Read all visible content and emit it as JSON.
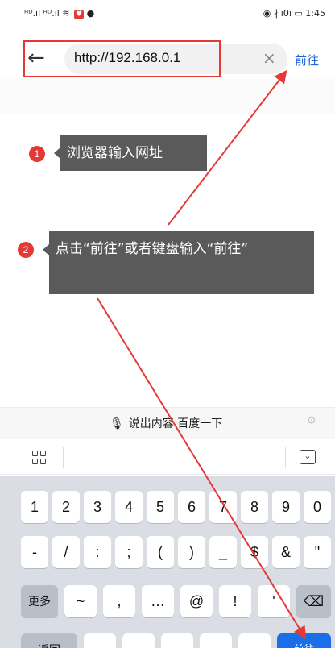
{
  "status_bar": {
    "signal_left": "ᴴᴰ.ıl ᴴᴰ.ıl ≋",
    "badge": "♥",
    "chat": "●",
    "right_icons": "◉ ∦ ı0ı ▭",
    "battery": "",
    "time": "1:45"
  },
  "address_bar": {
    "back_icon": "←",
    "url": "http://192.168.0.1",
    "clear_icon": "×",
    "go_label": "前往"
  },
  "callouts": [
    {
      "number": "1",
      "text": "浏览器输入网址"
    },
    {
      "number": "2",
      "text": "点击“前往”或者键盘输入“前往”"
    }
  ],
  "voice_bar": {
    "mic_icon": "🎙",
    "label": "说出内容 百度一下",
    "gear_icon": "⚙"
  },
  "keyboard": {
    "collapse_icon": "⌄",
    "row1": [
      "1",
      "2",
      "3",
      "4",
      "5",
      "6",
      "7",
      "8",
      "9",
      "0"
    ],
    "row2": [
      "-",
      "/",
      ":",
      ";",
      "(",
      ")",
      "_",
      "$",
      "&",
      "\""
    ],
    "more_label": "更多",
    "row3": [
      "~",
      ",",
      "…",
      "@",
      "!",
      "'"
    ],
    "backspace_icon": "⌫",
    "back_label": "返回",
    "go_label": "前往"
  },
  "colors": {
    "annotation_red": "#e53935",
    "link_blue": "#1a66d6",
    "callout_gray": "#5a5a5a",
    "keyboard_bg": "#dadde3",
    "go_key_blue": "#1a6ee8"
  }
}
